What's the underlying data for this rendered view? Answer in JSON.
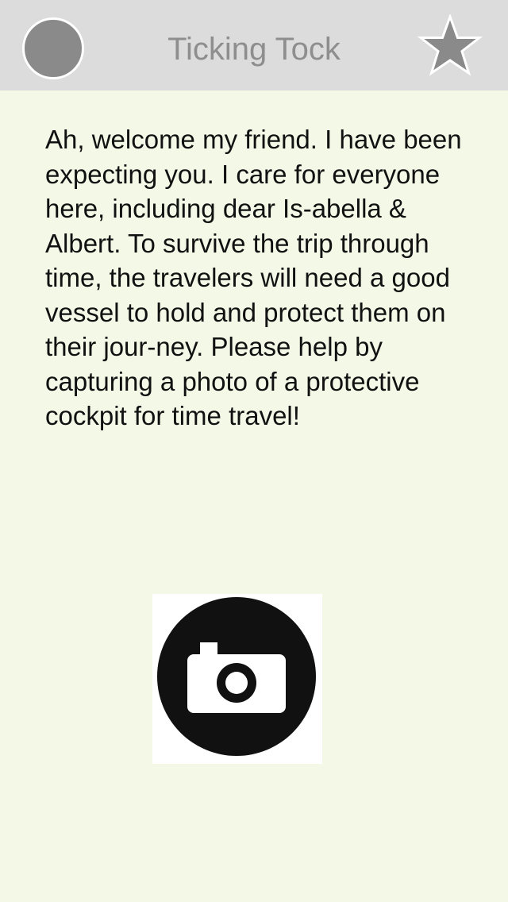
{
  "header": {
    "title": "Ticking Tock",
    "left_icon": "circle-icon",
    "right_icon": "star-icon"
  },
  "main": {
    "message": "Ah, welcome my friend. I have been expecting you. I care for everyone here, including dear Is-abella & Albert. To survive the trip through time, the travelers will need a good vessel to hold and protect them on their jour-ney. Please help by capturing a photo of a protective cockpit for time travel!",
    "camera_icon": "camera-icon"
  },
  "colors": {
    "header_bg": "#dcdcdc",
    "page_bg": "#f4f8e7",
    "icon_gray": "#8a8a8a",
    "title_gray": "#8e8e8e"
  }
}
